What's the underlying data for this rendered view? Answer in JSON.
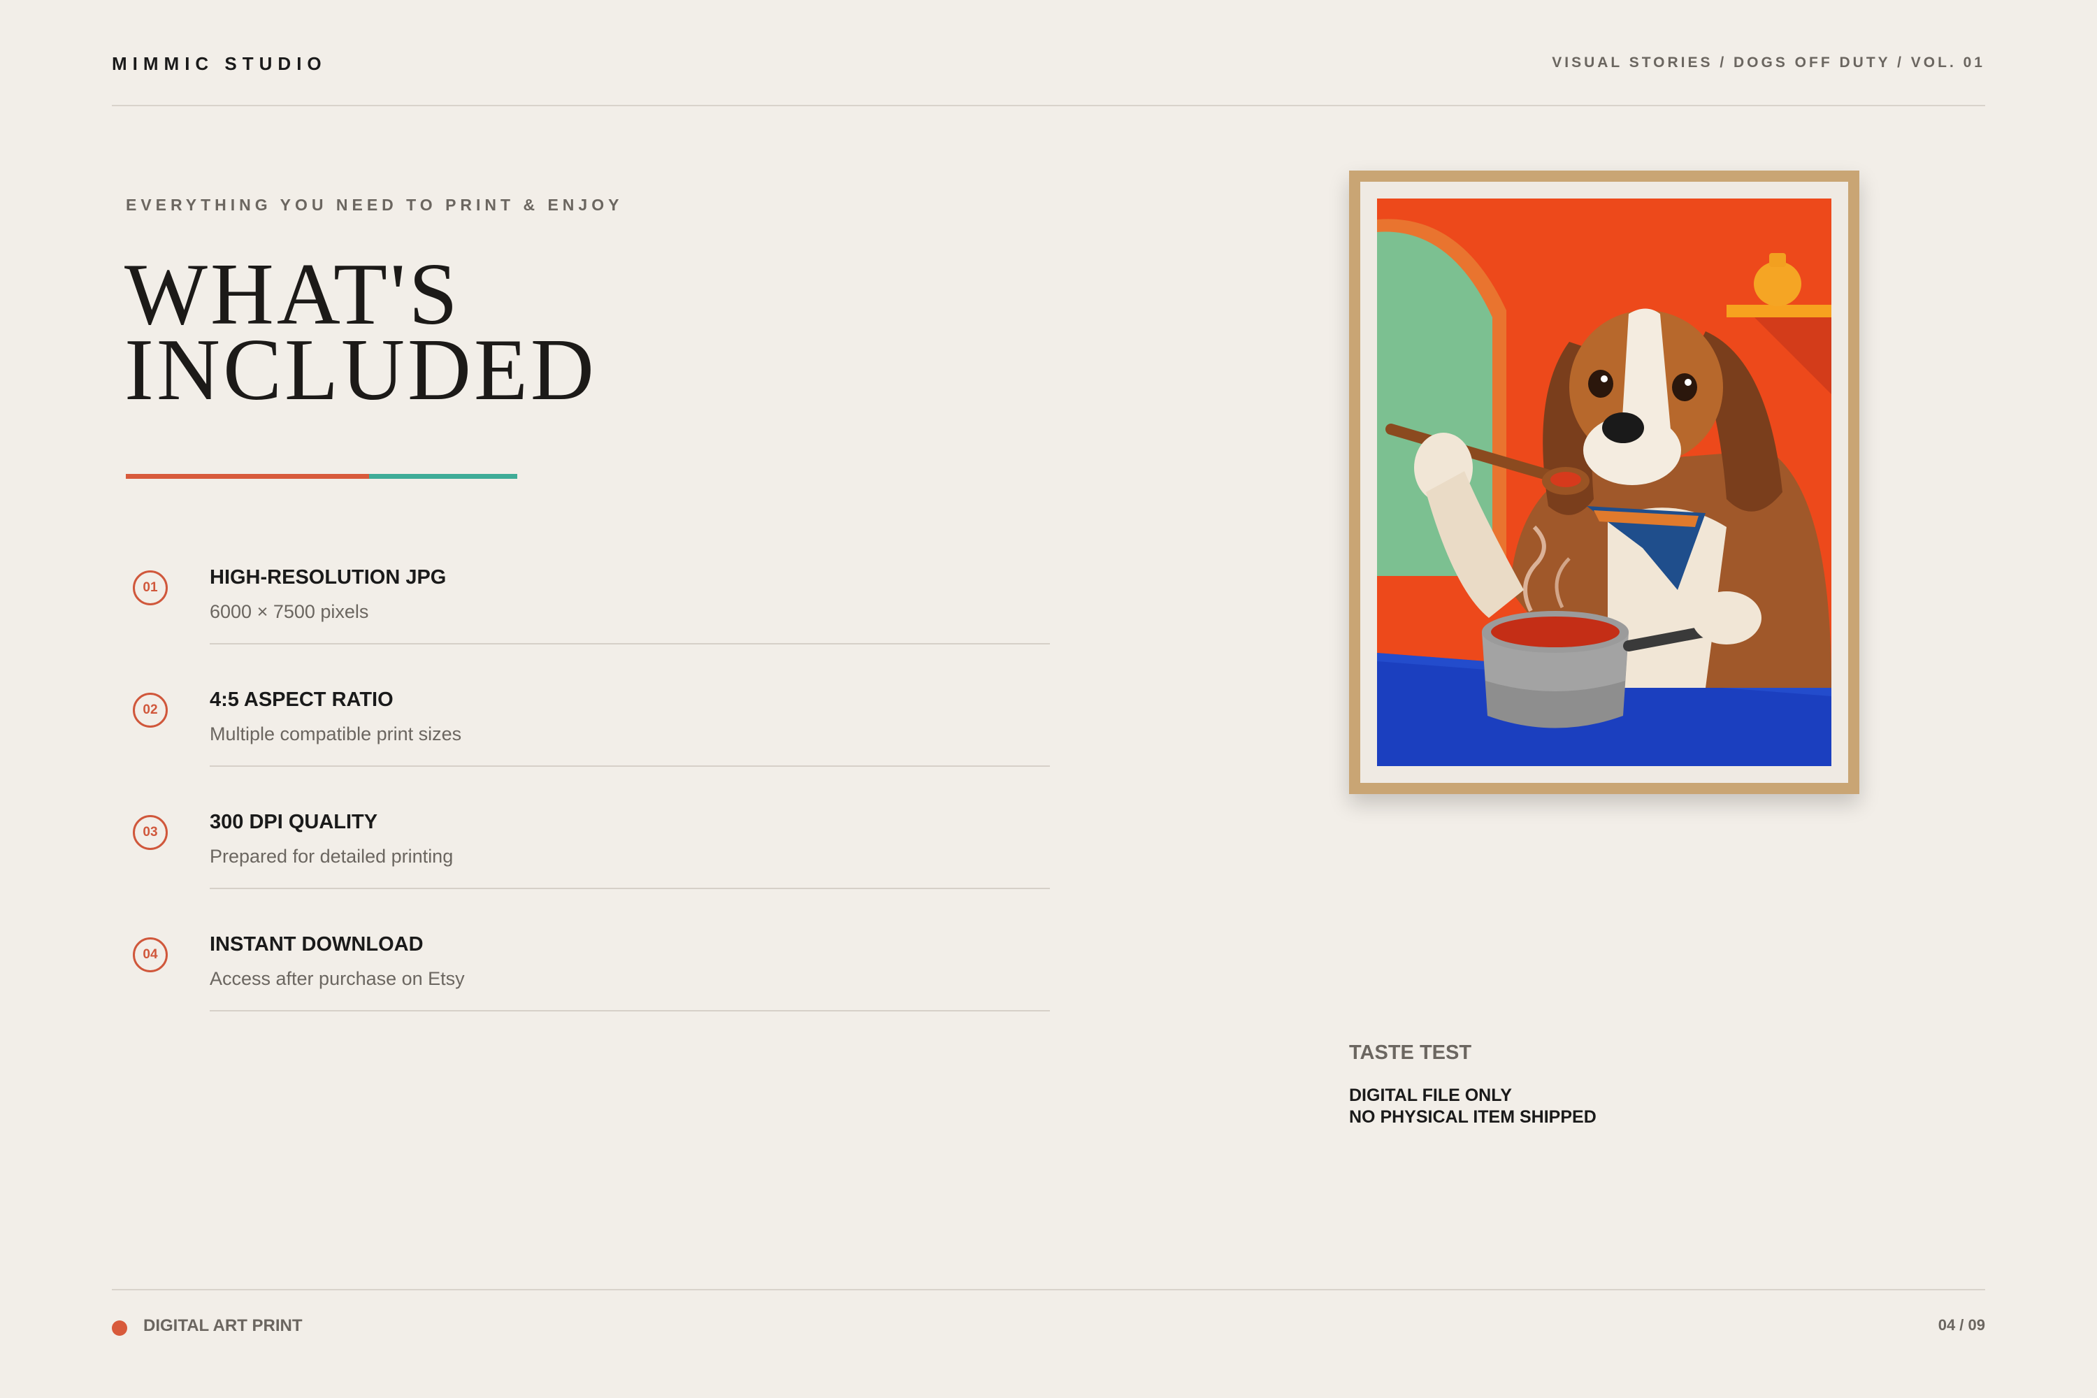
{
  "header": {
    "brand": "MIMMIC STUDIO",
    "breadcrumb": "VISUAL STORIES / DOGS OFF DUTY / VOL. 01"
  },
  "intro": {
    "eyebrow": "EVERYTHING YOU NEED TO PRINT & ENJOY",
    "title_line1": "WHAT'S",
    "title_line2": "INCLUDED"
  },
  "features": [
    {
      "number": "01",
      "title": "HIGH-RESOLUTION JPG",
      "description": "6000 × 7500 pixels"
    },
    {
      "number": "02",
      "title": "4:5 ASPECT RATIO",
      "description": "Multiple compatible print sizes"
    },
    {
      "number": "03",
      "title": "300 DPI QUALITY",
      "description": "Prepared for detailed printing"
    },
    {
      "number": "04",
      "title": "INSTANT DOWNLOAD",
      "description": "Access after purchase on Etsy"
    }
  ],
  "artwork": {
    "caption_title": "TASTE TEST",
    "caption_line1": "DIGITAL FILE ONLY",
    "caption_line2": "NO PHYSICAL ITEM SHIPPED"
  },
  "footer": {
    "label": "DIGITAL ART PRINT",
    "page": "04 / 09"
  },
  "colors": {
    "background": "#f2eee8",
    "accent_coral": "#d85a3b",
    "accent_teal": "#3fac97",
    "frame": "#c9a574"
  }
}
